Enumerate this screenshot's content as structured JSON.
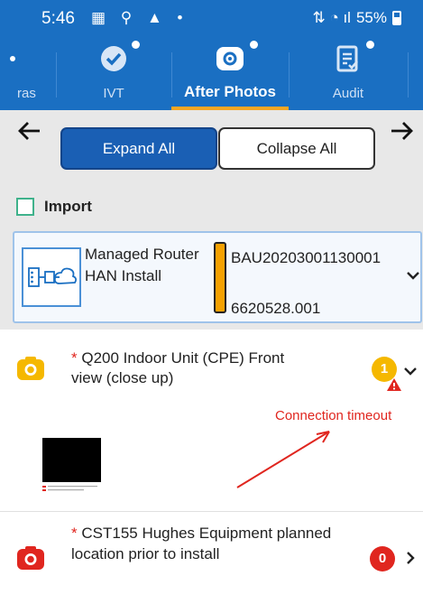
{
  "status_bar": {
    "time": "5:46",
    "battery": "55%"
  },
  "tabs": [
    {
      "label": "ras",
      "icon": "image-icon"
    },
    {
      "label": "IVT",
      "icon": "check-circle-icon"
    },
    {
      "label": "After Photos",
      "icon": "camera-icon",
      "active": true
    },
    {
      "label": "Audit",
      "icon": "clipboard-check-icon"
    }
  ],
  "toolbar": {
    "expand_label": "Expand All",
    "collapse_label": "Collapse All"
  },
  "import": {
    "label": "Import"
  },
  "job_card": {
    "title": "Managed Router HAN Install",
    "code": "BAU20203001130001",
    "sub_code": "6620528.001",
    "status_color": "#f5a100"
  },
  "items": [
    {
      "required_mark": "*",
      "title": "Q200 Indoor Unit (CPE) Front view (close up)",
      "count": "1",
      "count_color": "#f5b800",
      "error": "Connection timeout"
    },
    {
      "required_mark": "*",
      "title": "CST155 Hughes Equipment planned location prior to install",
      "count": "0",
      "count_color": "#e0261f"
    }
  ],
  "colors": {
    "brand_blue": "#1a6fc2",
    "accent_orange": "#f5a623",
    "error_red": "#e0261f"
  }
}
